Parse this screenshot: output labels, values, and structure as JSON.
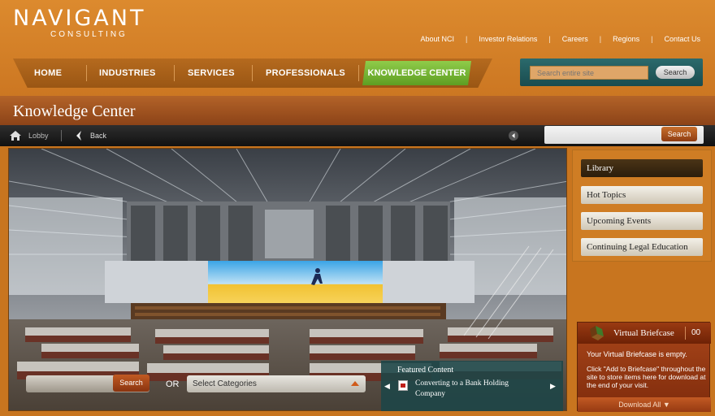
{
  "brand": {
    "name": "NAVIGANT",
    "tagline": "CONSULTING"
  },
  "top_links": [
    "About NCI",
    "Investor Relations",
    "Careers",
    "Regions",
    "Contact Us"
  ],
  "nav": {
    "items": [
      "HOME",
      "INDUSTRIES",
      "SERVICES",
      "PROFESSIONALS"
    ],
    "active": "KNOWLEDGE CENTER"
  },
  "site_search": {
    "placeholder": "Search entire site",
    "button": "Search"
  },
  "page_title": "Knowledge Center",
  "toolbar": {
    "lobby": "Lobby",
    "back": "Back",
    "search_button": "Search"
  },
  "side_menu": [
    "Library",
    "Hot Topics",
    "Upcoming Events",
    "Continuing Legal Education"
  ],
  "bottom_search": {
    "button": "Search",
    "or": "OR",
    "select": "Select Categories"
  },
  "featured": {
    "title": "Featured Content",
    "item": "Converting to a Bank Holding Company"
  },
  "briefcase": {
    "title": "Virtual Briefcase",
    "count": "00",
    "empty": "Your Virtual Briefcase is empty.",
    "instructions": "Click \"Add to Briefcase\" throughout the site to store items here for download at the end of your visit.",
    "download": "Download All"
  },
  "colors": {
    "orange": "#cc7722",
    "teal": "#1f5a5c",
    "green": "#6fb12e",
    "dark_red": "#8c4318"
  }
}
